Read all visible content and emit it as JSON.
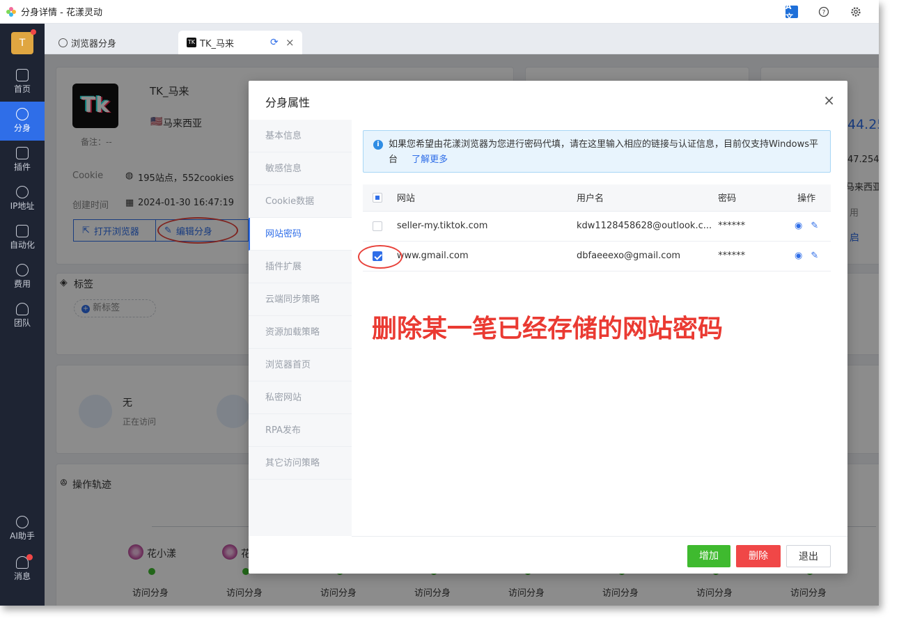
{
  "window": {
    "title": "分身详情 - 花漾灵动",
    "translate_icon": "A文"
  },
  "sidebar": {
    "avatar_letter": "T",
    "items": [
      {
        "label": "首页",
        "icon": "home-icon"
      },
      {
        "label": "分身",
        "icon": "browser-icon"
      },
      {
        "label": "插件",
        "icon": "plugin-icon"
      },
      {
        "label": "IP地址",
        "icon": "ip-icon"
      },
      {
        "label": "自动化",
        "icon": "robot-icon"
      },
      {
        "label": "费用",
        "icon": "yen-icon"
      },
      {
        "label": "团队",
        "icon": "team-icon"
      }
    ],
    "bottom_items": [
      {
        "label": "AI助手",
        "icon": "ai-icon"
      },
      {
        "label": "消息",
        "icon": "bell-icon"
      }
    ]
  },
  "tabs": [
    {
      "label": "浏览器分身"
    },
    {
      "label": "TK_马来",
      "icon_text": "TK",
      "close": "×",
      "refresh": "⟳"
    }
  ],
  "profile": {
    "logo_text": "Tk",
    "name": "TK_马来",
    "country": "马来西亚",
    "remark": "备注：--",
    "cookie_label": "Cookie",
    "cookie_value": "195站点，552cookies",
    "created_label": "创建时间",
    "created_value": "2024-01-30 16:47:19",
    "open_browser": "打开浏览器",
    "edit_profile": "编辑分身"
  },
  "tags": {
    "title": "标签",
    "new_tag": "新标签"
  },
  "visit": {
    "value": "无",
    "label": "正在访问"
  },
  "trail": {
    "title": "操作轨迹",
    "users": [
      "花小漾",
      "花"
    ],
    "labels": [
      "访问分身",
      "访问分身",
      "访问分身",
      "访问分身",
      "访问分身",
      "访问分身",
      "访问分身",
      "访问分身"
    ]
  },
  "right_peek": {
    "ip_big": "44.25",
    "ip_small": "47.254",
    "country": "马来西亚",
    "use": "用",
    "start": "启"
  },
  "dialog": {
    "title": "分身属性",
    "close": "×",
    "menu": [
      "基本信息",
      "敏感信息",
      "Cookie数据",
      "网站密码",
      "插件扩展",
      "云端同步策略",
      "资源加载策略",
      "浏览器首页",
      "私密网站",
      "RPA发布",
      "其它访问策略"
    ],
    "info_text": "如果您希望由花漾浏览器为您进行密码代填，请在这里输入相应的链接与认证信息，目前仅支持Windows平台",
    "info_link": "了解更多",
    "table": {
      "headers": [
        "网站",
        "用户名",
        "密码",
        "操作"
      ],
      "rows": [
        {
          "site": "seller-my.tiktok.com",
          "user": "kdw1128458628@outlook.c...",
          "password": "******",
          "checked": false
        },
        {
          "site": "www.gmail.com",
          "user": "dbfaeeexo@gmail.com",
          "password": "******",
          "checked": true
        }
      ]
    },
    "annotation": "删除某一笔已经存储的网站密码",
    "buttons": {
      "add": "增加",
      "delete": "删除",
      "exit": "退出"
    }
  },
  "colors": {
    "accent": "#2f6ee8",
    "sidebar_bg": "#1e2433",
    "add_green": "#3fba2f",
    "delete_red": "#f04747",
    "annotation_red": "#ea3a32"
  }
}
